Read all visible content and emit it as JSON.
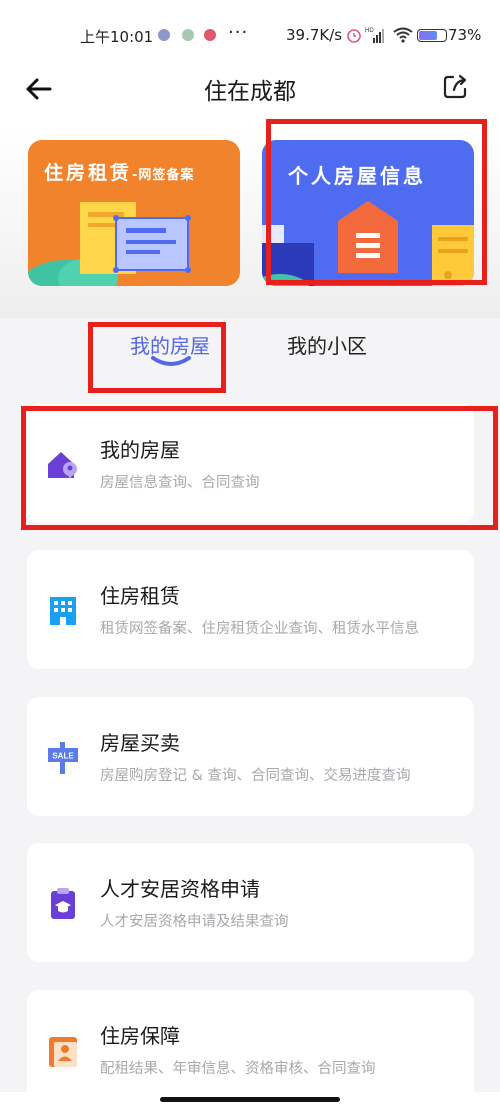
{
  "status_bar": {
    "time": "上午10:01",
    "more": "···",
    "network_speed": "39.7K/s",
    "battery": "73%",
    "battery_level": 0.73
  },
  "header": {
    "title": "住在成都"
  },
  "banners": [
    {
      "title": "住房租赁",
      "suffix": "-网签备案",
      "color": "#f2832d"
    },
    {
      "title": "个人房屋信息",
      "color": "#4f6cf0"
    }
  ],
  "tabs": [
    {
      "label": "我的房屋",
      "active": true
    },
    {
      "label": "我的小区",
      "active": false
    }
  ],
  "cards": [
    {
      "title": "我的房屋",
      "subtitle": "房屋信息查询、合同查询",
      "icon": "house-location-icon"
    },
    {
      "title": "住房租赁",
      "subtitle": "租赁网签备案、住房租赁企业查询、租赁水平信息",
      "icon": "building-icon"
    },
    {
      "title": "房屋买卖",
      "subtitle": "房屋购房登记 & 查询、合同查询、交易进度查询",
      "icon": "sale-sign-icon"
    },
    {
      "title": "人才安居资格申请",
      "subtitle": "人才安居资格申请及结果查询",
      "icon": "clipboard-graduate-icon"
    },
    {
      "title": "住房保障",
      "subtitle": "配租结果、年审信息、资格审核、合同查询",
      "icon": "housing-security-icon"
    }
  ],
  "colors": {
    "accent": "#5466e6",
    "highlight_box": "#e8201c"
  }
}
